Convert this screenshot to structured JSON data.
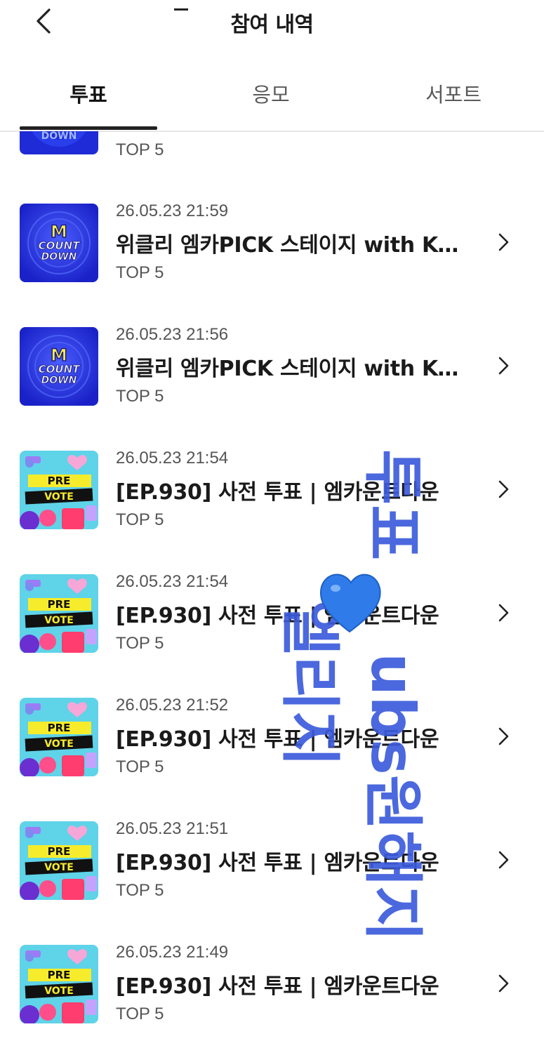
{
  "header": {
    "title": "참여 내역"
  },
  "tabs": [
    {
      "label": "투표",
      "active": true
    },
    {
      "label": "응모",
      "active": false
    },
    {
      "label": "서포트",
      "active": false
    }
  ],
  "partial_row": {
    "sub": "TOP 5",
    "thumb": "countdown-logo"
  },
  "items": [
    {
      "date": "26.05.23 21:59",
      "title": "위클리 엠카PICK 스테이지 with KU...",
      "sub": "TOP 5",
      "thumb": "countdown-logo"
    },
    {
      "date": "26.05.23 21:56",
      "title": "위클리 엠카PICK 스테이지 with KU...",
      "sub": "TOP 5",
      "thumb": "countdown-logo"
    },
    {
      "date": "26.05.23 21:54",
      "title": "[EP.930] 사전 투표 | 엠카운트다운",
      "sub": "TOP 5",
      "thumb": "pre-vote-logo"
    },
    {
      "date": "26.05.23 21:54",
      "title": "[EP.930] 사전 투표 | 엠카운트다운",
      "sub": "TOP 5",
      "thumb": "pre-vote-logo"
    },
    {
      "date": "26.05.23 21:52",
      "title": "[EP.930] 사전 투표 | 엠카운트다운",
      "sub": "TOP 5",
      "thumb": "pre-vote-logo"
    },
    {
      "date": "26.05.23 21:51",
      "title": "[EP.930] 사전 투표 | 엠카운트다운",
      "sub": "TOP 5",
      "thumb": "pre-vote-logo"
    },
    {
      "date": "26.05.23 21:49",
      "title": "[EP.930] 사전 투표 | 엠카운트다운",
      "sub": "TOP 5",
      "thumb": "pre-vote-logo"
    }
  ],
  "thumb_text": {
    "countdown_top": "COUNT",
    "countdown_bottom": "DOWN",
    "countdown_m": "M",
    "prevote_top": "PRE",
    "prevote_bottom": "VOTE"
  },
  "overlay": {
    "left_text": "엘리지",
    "right_top_text": "투표",
    "right_bottom_text": "ubs원해지",
    "color": "#3b5bdb",
    "heart_color": "#2f7bea"
  },
  "colors": {
    "countdown_bg": "#1e2bd6",
    "prevote_bg": "#5fd3e8",
    "prevote_band": "#f7ec2b",
    "accent": "#222222"
  }
}
